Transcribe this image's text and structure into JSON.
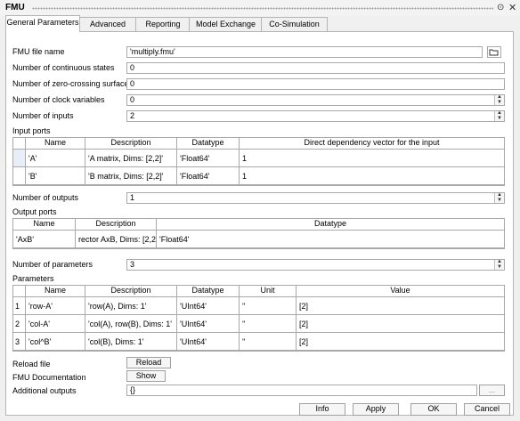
{
  "window": {
    "title": "FMU"
  },
  "tabs": [
    "General Parameters",
    "Advanced",
    "Reporting",
    "Model Exchange",
    "Co-Simulation"
  ],
  "fields": {
    "fmu_file_name": {
      "label": "FMU file name",
      "value": "'multiply.fmu'"
    },
    "continuous_states": {
      "label": "Number of continuous states",
      "value": "0"
    },
    "zero_crossing": {
      "label": "Number of zero-crossing surfaces",
      "value": "0"
    },
    "clock_vars": {
      "label": "Number of clock variables",
      "value": "0"
    },
    "num_inputs": {
      "label": "Number of inputs",
      "value": "2"
    },
    "num_outputs": {
      "label": "Number of outputs",
      "value": "1"
    },
    "num_params": {
      "label": "Number of parameters",
      "value": "3"
    },
    "additional_outputs": {
      "label": "Additional outputs",
      "value": "{}"
    }
  },
  "input_ports": {
    "label": "Input ports",
    "headers": [
      "Name",
      "Description",
      "Datatype",
      "Direct dependency vector for the input"
    ],
    "rows": [
      [
        "'A'",
        "'A matrix, Dims: [2,2]'",
        "'Float64'",
        "1"
      ],
      [
        "'B'",
        "'B matrix, Dims: [2,2]'",
        "'Float64'",
        "1"
      ]
    ]
  },
  "output_ports": {
    "label": "Output ports",
    "headers": [
      "Name",
      "Description",
      "Datatype"
    ],
    "rows": [
      [
        "'AxB'",
        "rector AxB, Dims: [2,2]'",
        "'Float64'"
      ]
    ]
  },
  "parameters": {
    "label": "Parameters",
    "headers": [
      "Name",
      "Description",
      "Datatype",
      "Unit",
      "Value"
    ],
    "rows": [
      [
        "1",
        "'row-A'",
        "'row(A), Dims: 1'",
        "'UInt64'",
        "''",
        "[2]"
      ],
      [
        "2",
        "'col-A'",
        "'col(A), row(B), Dims: 1'",
        "'UInt64'",
        "''",
        "[2]"
      ],
      [
        "3",
        "'col^B'",
        "'col(B), Dims: 1'",
        "'UInt64'",
        "''",
        "[2]"
      ]
    ]
  },
  "reload": {
    "label": "Reload file",
    "button": "Reload"
  },
  "doc": {
    "label": "FMU Documentation",
    "button": "Show"
  },
  "ellipsis": "...",
  "buttons": {
    "info": "Info",
    "apply": "Apply",
    "ok": "OK",
    "cancel": "Cancel"
  }
}
